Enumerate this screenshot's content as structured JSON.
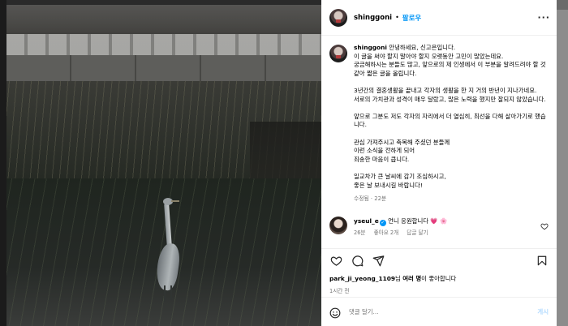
{
  "post": {
    "username": "shinggoni",
    "separator": "•",
    "follow_label": "팔로우",
    "more_label": "···"
  },
  "caption": {
    "username": "shinggoni",
    "lines": [
      "안녕하세요, 신고은입니다.",
      "이 글을 써야 할지 말아야 할지 오랫동안 고민이 많았는데요.",
      "궁금해하시는 분들도 많고, 앞으로의 제 인생에서 이 부분을 알려드려야 할 것 같아 짧은 글을 올립니다.",
      "",
      "3년간의 결혼생활을 끝내고 각자의 생활을 한 지 거의 반년이 지나가네요.",
      "서로의 가치관과 성격이 매우 달랐고, 많은 노력을 했지만 잘되지 않았습니다.",
      "",
      "앞으로 그분도 저도 각자의 자리에서 더 열심히, 최선을 다해 살아가기로 했습니다.",
      "",
      "관심 가져주시고 축복해 주셨던 분들께",
      "이런 소식을 전하게 되어",
      "죄송한 마음이 큽니다.",
      "",
      "일교차가 큰 날씨에 감기 조심하시고,",
      "좋은 날 보내시길 바랍니다!"
    ],
    "meta": "수정됨 · 22분"
  },
  "comment": {
    "username": "yseul_e",
    "text": "언니 응원합니다 💗 🌸",
    "time": "26분",
    "likes": "좋아요 2개",
    "reply": "답글 달기"
  },
  "actions": {
    "icons": [
      "heart-icon",
      "comment-icon",
      "share-icon",
      "bookmark-icon"
    ]
  },
  "likes": {
    "user": "park_ji_yeong_1109",
    "suffix": "님 ",
    "others": "여러 명",
    "tail": "이 좋아합니다"
  },
  "time": "1시간 전",
  "compose": {
    "placeholder": "댓글 달기...",
    "post_label": "게시"
  },
  "colors": {
    "accent": "#0095f6",
    "muted": "#737373",
    "post_disabled": "#b3dbff"
  }
}
